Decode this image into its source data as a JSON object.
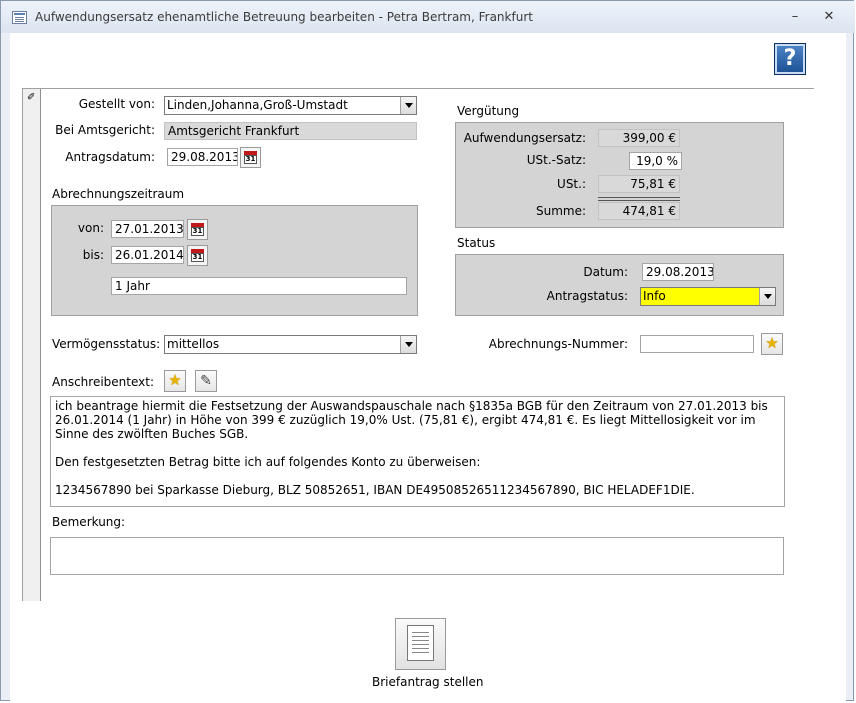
{
  "window": {
    "title": "Aufwendungsersatz ehenamtliche Betreuung bearbeiten - Petra Bertram, Frankfurt",
    "minimize_glyph": "–",
    "close_glyph": "✕"
  },
  "help": {
    "glyph": "?"
  },
  "form": {
    "selector_glyph": "✐",
    "gestellt_von": {
      "label": "Gestellt von:",
      "value": "Linden,Johanna,Groß-Umstadt"
    },
    "amtsgericht": {
      "label": "Bei Amtsgericht:",
      "value": "Amtsgericht Frankfurt"
    },
    "antragsdatum": {
      "label": "Antragsdatum:",
      "value": "29.08.2013"
    },
    "abrechnungszeitraum": {
      "title": "Abrechnungszeitraum",
      "von_label": "von:",
      "von": "27.01.2013",
      "bis_label": "bis:",
      "bis": "26.01.2014",
      "dauer": "1 Jahr"
    },
    "calendar_day": "31",
    "verguetung": {
      "title": "Vergütung",
      "aufwendungsersatz_label": "Aufwendungsersatz:",
      "aufwendungsersatz": "399,00 €",
      "ust_satz_label": "USt.-Satz:",
      "ust_satz": "19,0 %",
      "ust_label": "USt.:",
      "ust": "75,81 €",
      "summe_label": "Summe:",
      "summe": "474,81 €"
    },
    "status": {
      "title": "Status",
      "datum_label": "Datum:",
      "datum": "29.08.2013",
      "antragstatus_label": "Antragstatus:",
      "antragstatus": "Info",
      "highlight_color": "#ffff00"
    },
    "vermoegensstatus": {
      "label": "Vermögensstatus:",
      "value": "mittellos"
    },
    "abrechnungs_nummer": {
      "label": "Abrechnungs-Nummer:",
      "value": ""
    },
    "anschreibentext": {
      "label": "Anschreibentext:",
      "paragraphs": [
        "ich beantrage hiermit die Festsetzung der Auswandspauschale nach §1835a BGB für den Zeitraum von 27.01.2013 bis 26.01.2014 (1 Jahr) in Höhe von 399 € zuzüglich 19,0% Ust. (75,81 €), ergibt 474,81 €. Es liegt Mittellosigkeit vor im Sinne des zwölften Buches SGB.",
        "Den festgesetzten Betrag bitte ich auf folgendes Konto zu überweisen:",
        "1234567890 bei Sparkasse Dieburg, BLZ 50852651, IBAN DE49508526511234567890, BIC HELADEF1DIE."
      ]
    },
    "bemerkung": {
      "label": "Bemerkung:",
      "value": ""
    },
    "icons": {
      "star": "★",
      "pen": "✎"
    }
  },
  "footer": {
    "briefantrag_label": "Briefantrag stellen"
  }
}
